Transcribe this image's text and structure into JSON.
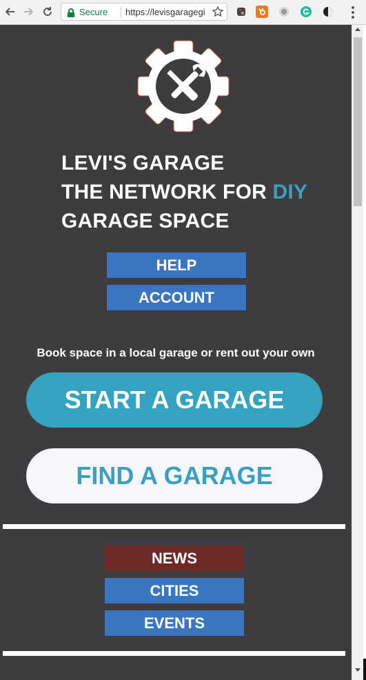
{
  "browser": {
    "secure_label": "Secure",
    "url": "https://levisgaragegi",
    "icons": [
      "back-icon",
      "forward-icon",
      "reload-icon",
      "lock-icon",
      "star-icon",
      "evernote-icon",
      "hubspot-icon",
      "extension-icon",
      "grammarly-icon",
      "dark-mode-icon",
      "menu-icon"
    ]
  },
  "header": {
    "title_line1": "LEVI'S GARAGE",
    "title_line2_prefix": "THE NETWORK FOR ",
    "title_line2_accent": "DIY",
    "title_line3": "GARAGE SPACE"
  },
  "top_nav": {
    "help": "HELP",
    "account": "ACCOUNT"
  },
  "tagline": "Book space in a local garage or rent out your own",
  "cta": {
    "start": "START A GARAGE",
    "find": "FIND A GARAGE"
  },
  "bottom_nav": {
    "news": "NEWS",
    "cities": "CITIES",
    "events": "EVENTS"
  },
  "colors": {
    "background": "#3e3c3f",
    "accent": "#39a0bf",
    "nav_blue": "#3a77c0",
    "news_red": "#6e2a27",
    "find_bg": "#f7f6fd"
  }
}
